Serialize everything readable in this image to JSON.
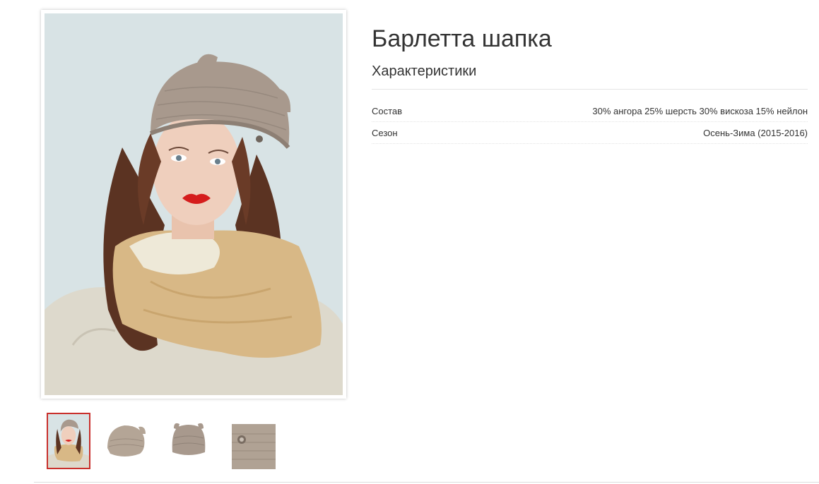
{
  "product": {
    "title": "Барлетта шапка"
  },
  "specs": {
    "heading": "Характеристики",
    "rows": [
      {
        "name": "Состав",
        "value": "30% ангора 25% шерсть 30% вискоза 15% нейлон"
      },
      {
        "name": "Сезон",
        "value": "Осень-Зима (2015-2016)"
      }
    ]
  },
  "gallery": {
    "main_image": "model-wearing-knitted-hat-photo",
    "thumbnails": [
      {
        "name": "model-photo",
        "active": true
      },
      {
        "name": "hat-side-view",
        "active": false
      },
      {
        "name": "hat-front-view",
        "active": false
      },
      {
        "name": "hat-detail-view",
        "active": false
      }
    ]
  },
  "colors": {
    "active_thumb_border": "#c9302c",
    "hat": "#a8998d",
    "photo_background": "#d9e4e6"
  }
}
